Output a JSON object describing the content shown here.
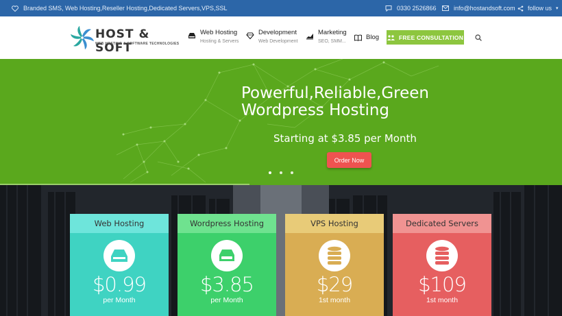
{
  "topbar": {
    "tagline": "Branded SMS, Web Hosting,Reseller Hosting,Dedicated Servers,VPS,SSL",
    "phone": "0330 2526866",
    "email": "info@hostandsoft.com",
    "follow": "follow us",
    "caret": "▾"
  },
  "logo": {
    "name": "HOST & SOFT",
    "subtitle": "WEB HOSTING & SOFTWARE TECHNOLOGIES"
  },
  "nav": {
    "items": [
      {
        "title": "Web Hosting",
        "sub": "Hosting & Servers",
        "icon": "server-tray-icon"
      },
      {
        "title": "Development",
        "sub": "Web Development",
        "icon": "diamond-icon"
      },
      {
        "title": "Marketing",
        "sub": "SEO, SMM...",
        "icon": "chart-icon"
      }
    ],
    "blog": "Blog",
    "consult": "FREE CONSULTATION"
  },
  "hero": {
    "title_line1": "Powerful,Reliable,Green",
    "title_line2": "Wordpress Hosting",
    "subtitle": "Starting at $3.85 per Month",
    "cta": "Order Now",
    "active_slide": 1,
    "slide_progress": 0.444
  },
  "colors": {
    "topbar": "#2c66a8",
    "hero": "#5aa81d",
    "consult": "#8dc63f",
    "order": "#ef5350"
  },
  "plans": [
    {
      "title": "Web Hosting",
      "price": "$0.99",
      "period": "per Month",
      "icon": "hdd-tray-icon",
      "header_color": "#6ee5db",
      "body_color": "#3fd3c2",
      "icon_color": "#3fd3c2"
    },
    {
      "title": "Wordpress Hosting",
      "price": "$3.85",
      "period": "per Month",
      "icon": "hard-drive-icon",
      "header_color": "#6fe28f",
      "body_color": "#3dd06b",
      "icon_color": "#3dd06b"
    },
    {
      "title": "VPS Hosting",
      "price": "$29",
      "period": "1st month",
      "icon": "database-icon",
      "header_color": "#e8cb78",
      "body_color": "#d9ad53",
      "icon_color": "#d9ad53"
    },
    {
      "title": "Dedicated Servers",
      "price": "$109",
      "period": "1st month",
      "icon": "database-icon",
      "header_color": "#f09392",
      "body_color": "#e65f60",
      "icon_color": "#e65f60"
    }
  ]
}
